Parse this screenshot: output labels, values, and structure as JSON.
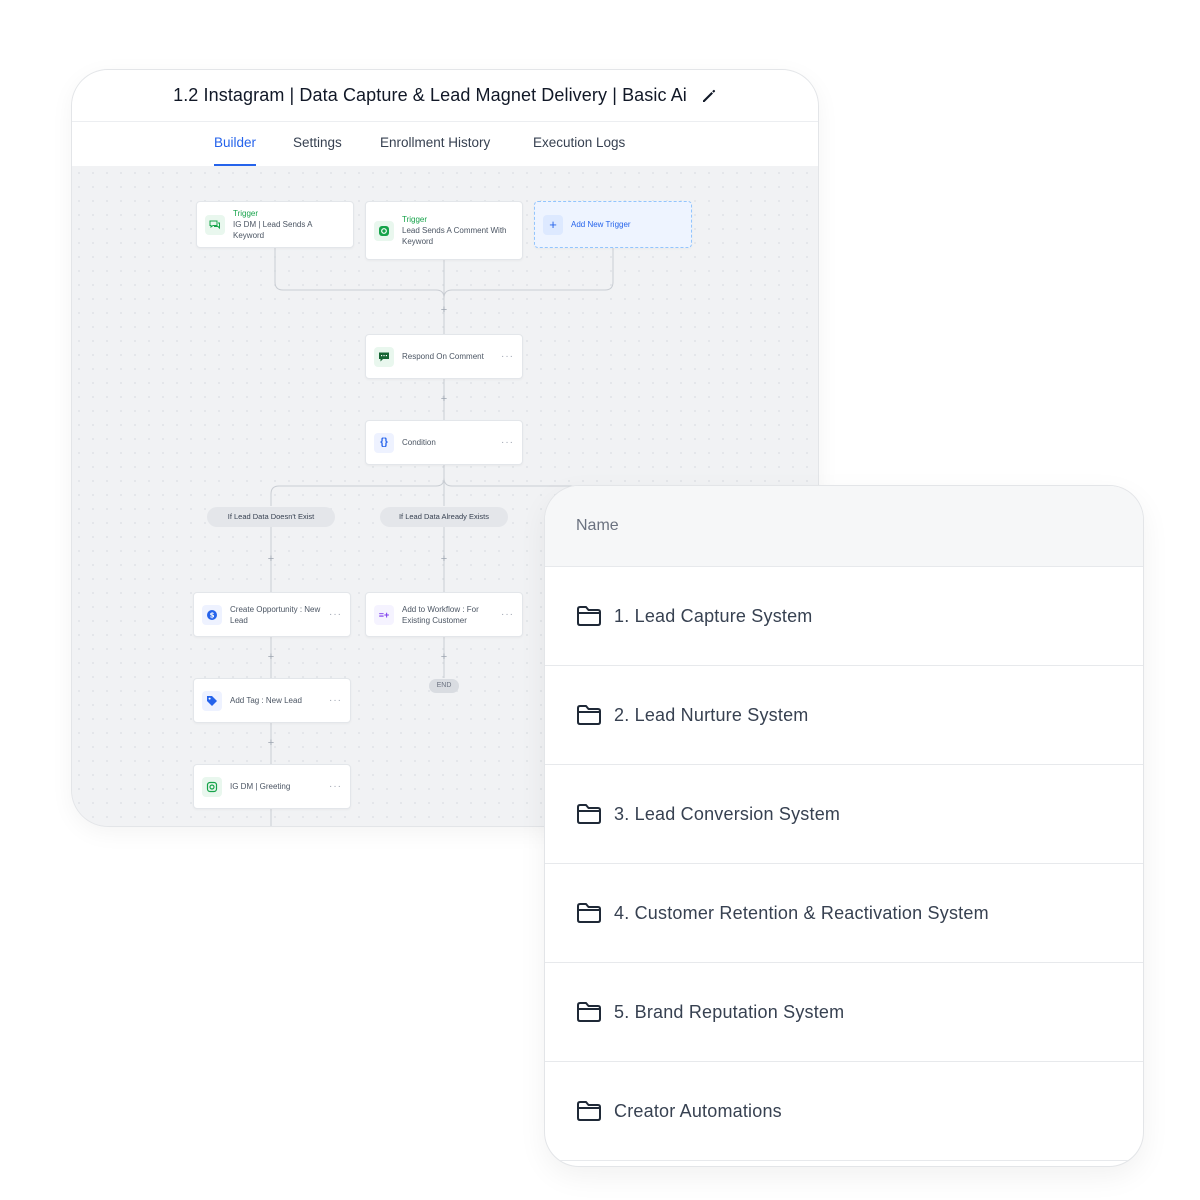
{
  "workflow": {
    "title": "1.2 Instagram | Data Capture & Lead Magnet Delivery | Basic Ai",
    "tabs": [
      {
        "label": "Builder",
        "active": true
      },
      {
        "label": "Settings",
        "active": false
      },
      {
        "label": "Enrollment History",
        "active": false
      },
      {
        "label": "Execution Logs",
        "active": false
      }
    ],
    "triggers": [
      {
        "kind": "Trigger",
        "label": "IG DM | Lead Sends A Keyword",
        "icon": "chat-bubbles-icon"
      },
      {
        "kind": "Trigger",
        "label": "Lead Sends A Comment With Keyword",
        "icon": "instagram-icon"
      }
    ],
    "add_trigger_label": "Add New Trigger",
    "actions": {
      "respond": "Respond On Comment",
      "condition": "Condition",
      "branch_left": "If Lead Data Doesn't Exist",
      "branch_right": "If Lead Data Already Exists",
      "create_opportunity": "Create Opportunity : New Lead",
      "add_to_workflow": "Add to Workflow : For Existing Customer",
      "add_tag": "Add Tag : New Lead",
      "ig_greeting": "IG DM | Greeting",
      "end_label": "END"
    },
    "colors": {
      "accent": "#2563eb",
      "green": "#16a34a",
      "purple": "#7c3aed"
    }
  },
  "folders": {
    "header": "Name",
    "items": [
      {
        "label": "1. Lead Capture System"
      },
      {
        "label": "2. Lead Nurture System"
      },
      {
        "label": "3. Lead Conversion System"
      },
      {
        "label": "4. Customer Retention & Reactivation System"
      },
      {
        "label": "5. Brand Reputation System"
      },
      {
        "label": "Creator Automations"
      }
    ]
  }
}
